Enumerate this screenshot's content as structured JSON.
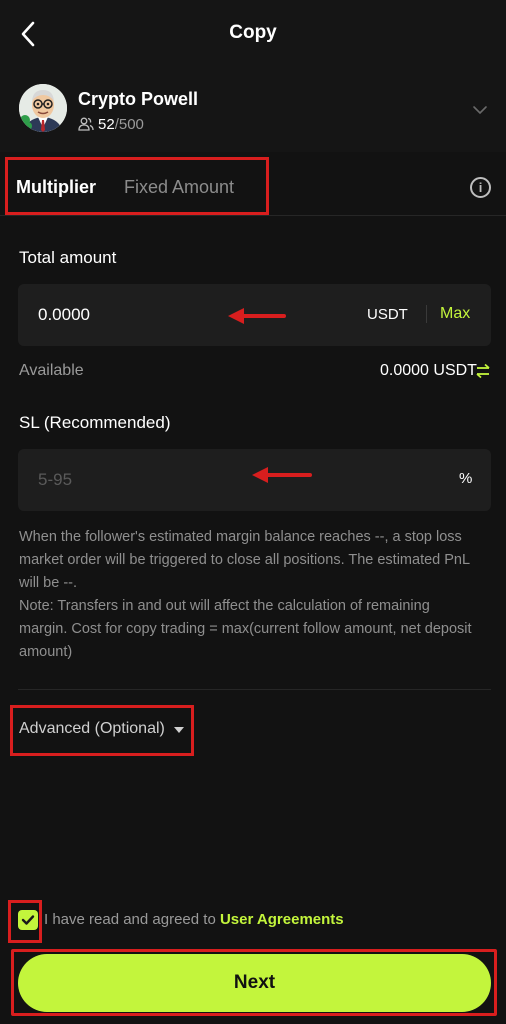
{
  "header": {
    "title": "Copy"
  },
  "trader": {
    "name": "Crypto Powell",
    "followers": "52",
    "max_followers": "/500"
  },
  "tabs": [
    {
      "label": "Multiplier"
    },
    {
      "label": "Fixed Amount"
    }
  ],
  "total_amount": {
    "label": "Total amount",
    "value": "0.0000",
    "unit": "USDT",
    "max_label": "Max"
  },
  "available": {
    "label": "Available",
    "value": "0.0000 USDT"
  },
  "stop_loss": {
    "label": "SL (Recommended)",
    "placeholder": "5-95",
    "unit": "%"
  },
  "note": "When the follower's estimated margin balance reaches --, a stop loss market order will be triggered to close all positions. The estimated PnL will be --.\nNote: Transfers in and out will affect the calculation of remaining margin. Cost for copy trading = max(current follow amount, net deposit amount)",
  "advanced": {
    "label": "Advanced (Optional)"
  },
  "agreement": {
    "text": "I have read and agreed to ",
    "link": "User Agreements",
    "checked": true
  },
  "next_button": {
    "label": "Next"
  },
  "colors": {
    "accent": "#c3f53c",
    "background": "#121212",
    "field": "#1e1e1e",
    "annotation": "#d81e1e"
  },
  "icons": [
    "back-arrow-icon",
    "people-icon",
    "chevron-down-icon",
    "info-icon",
    "swap-icon",
    "caret-down-icon",
    "check-icon",
    "red-arrow-icon"
  ]
}
